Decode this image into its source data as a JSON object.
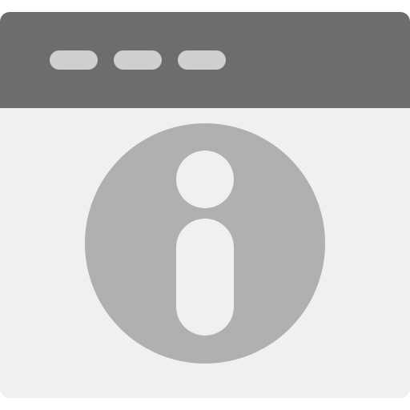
{
  "colors": {
    "titlebar": "#6d6d6d",
    "body": "#f0f0f0",
    "dots": "#cfcfcf",
    "info_circle": "#b0b0b0",
    "info_glyph": "#f0f0f0"
  },
  "titlebar": {
    "controls": [
      "window-control",
      "window-control",
      "window-control"
    ]
  },
  "icon": {
    "name": "info-icon"
  }
}
